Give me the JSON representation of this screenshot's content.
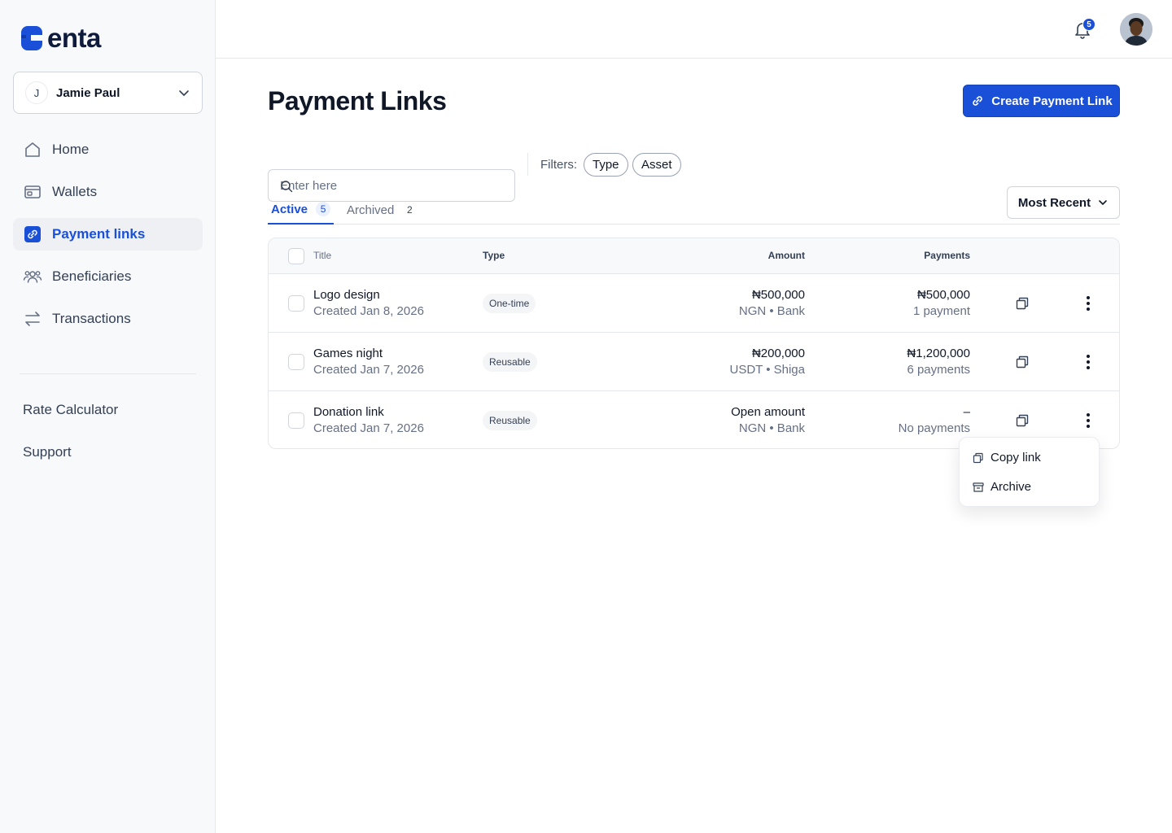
{
  "brand": {
    "name": "enta",
    "accent": "#1a4fd8"
  },
  "account": {
    "initial": "J",
    "name": "Jamie Paul"
  },
  "nav": [
    {
      "label": "Home",
      "icon": "home-icon"
    },
    {
      "label": "Wallets",
      "icon": "wallet-icon"
    },
    {
      "label": "Payment links",
      "icon": "link-icon",
      "active": true
    },
    {
      "label": "Beneficiaries",
      "icon": "users-icon"
    },
    {
      "label": "Transactions",
      "icon": "arrows-icon"
    }
  ],
  "secondary_nav": [
    "Rate Calculator",
    "Support"
  ],
  "topbar": {
    "notification_count": "5"
  },
  "page": {
    "title": "Payment Links",
    "create_label": "Create Payment Link"
  },
  "search": {
    "placeholder": "Enter here"
  },
  "filters": {
    "label": "Filters:",
    "chips": [
      "Type",
      "Asset"
    ]
  },
  "tabs": [
    {
      "label": "Active",
      "count": "5",
      "active": true
    },
    {
      "label": "Archived",
      "count": "2"
    }
  ],
  "sort": {
    "label": "Most Recent"
  },
  "table": {
    "headers": {
      "title": "Title",
      "type": "Type",
      "amount": "Amount",
      "payments": "Payments"
    },
    "rows": [
      {
        "title": "Logo design",
        "created": "Created Jan 8, 2026",
        "type": "One-time",
        "amount": "₦500,000",
        "amount_sub": "NGN  •  Bank",
        "payments": "₦500,000",
        "payments_sub": "1 payment"
      },
      {
        "title": "Games night",
        "created": "Created Jan 7, 2026",
        "type": "Reusable",
        "amount": "₦200,000",
        "amount_sub": "USDT  •  Shiga",
        "payments": "₦1,200,000",
        "payments_sub": "6 payments"
      },
      {
        "title": "Donation link",
        "created": "Created Jan 7, 2026",
        "type": "Reusable",
        "amount": "Open amount",
        "amount_sub": "NGN  •  Bank",
        "payments": "–",
        "payments_sub": "No payments"
      }
    ]
  },
  "row_menu": {
    "copy_label": "Copy link",
    "archive_label": "Archive"
  }
}
